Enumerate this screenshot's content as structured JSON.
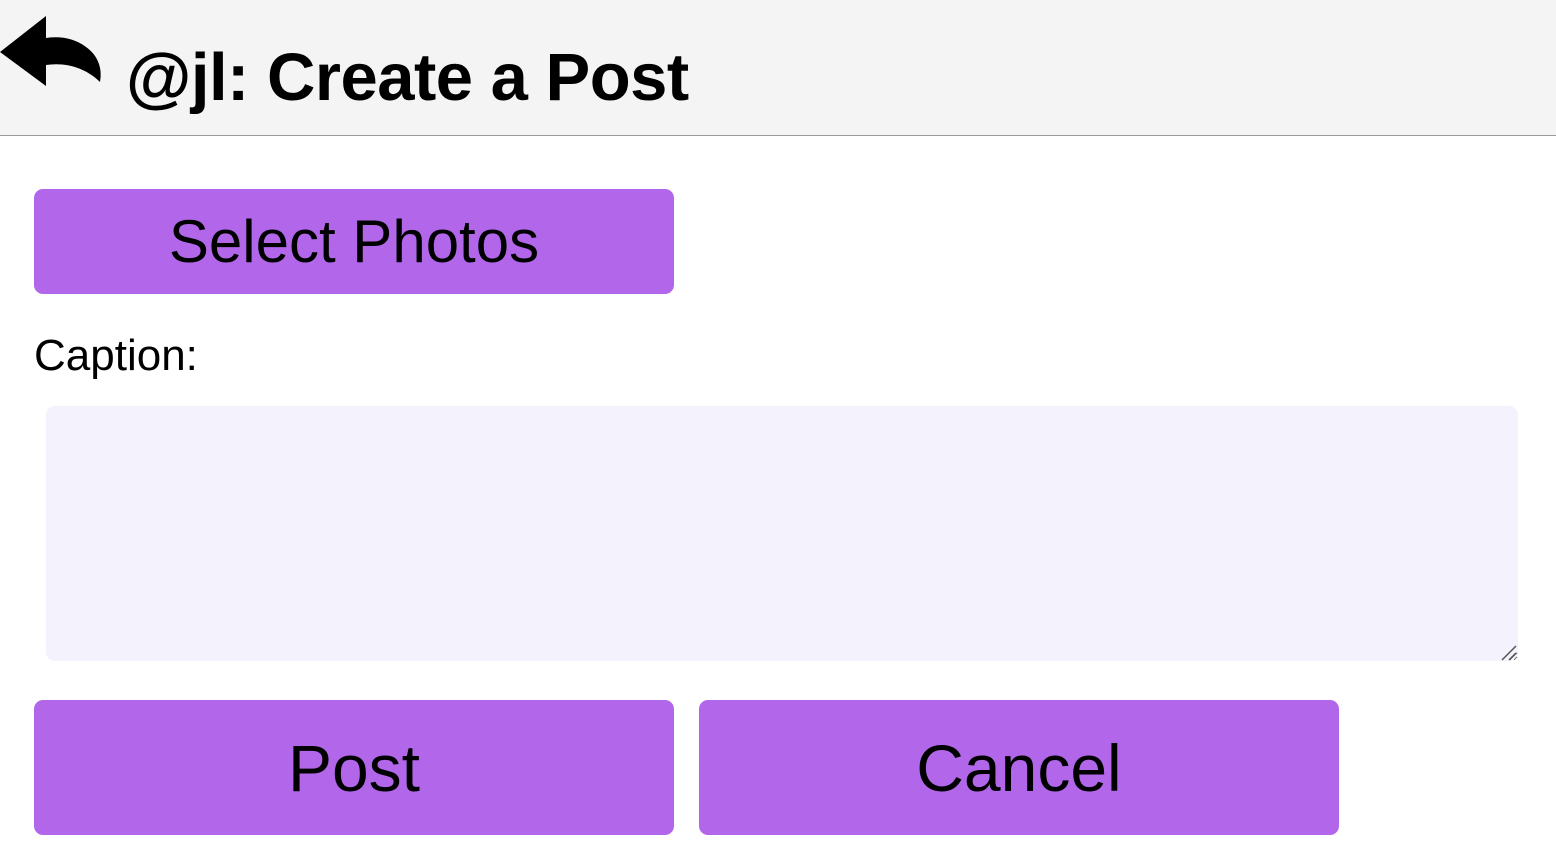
{
  "header": {
    "back_icon": "reply-arrow-icon",
    "title": "@jl: Create a Post"
  },
  "form": {
    "select_photos_label": "Select Photos",
    "caption_label": "Caption:",
    "caption_value": "",
    "post_label": "Post",
    "cancel_label": "Cancel"
  },
  "colors": {
    "header_bg": "#f4f4f4",
    "button_bg": "#b267eb",
    "textarea_bg": "#f4f2fd",
    "text": "#000000"
  }
}
